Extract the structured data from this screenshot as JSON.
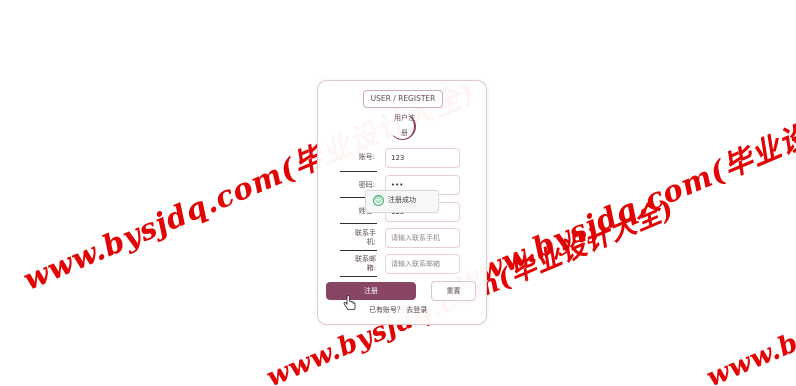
{
  "watermark": {
    "text": "www.bysjdq.com(毕业设计大全)"
  },
  "card": {
    "title": "USER / REGISTER",
    "avatar_text": "用户注册"
  },
  "form": {
    "account_label": "账号:",
    "account_value": "123",
    "password_label": "密码:",
    "password_value": "•••",
    "name_label": "姓名:",
    "name_value": "123",
    "phone_label": "联系手机:",
    "phone_placeholder": "请输入联系手机",
    "email_label": "联系邮箱:",
    "email_placeholder": "请输入联系邮箱"
  },
  "toast": {
    "text": "注册成功"
  },
  "actions": {
    "submit": "注册",
    "reset": "重置"
  },
  "footer": {
    "login_text": "已有账号？ 去登录"
  }
}
